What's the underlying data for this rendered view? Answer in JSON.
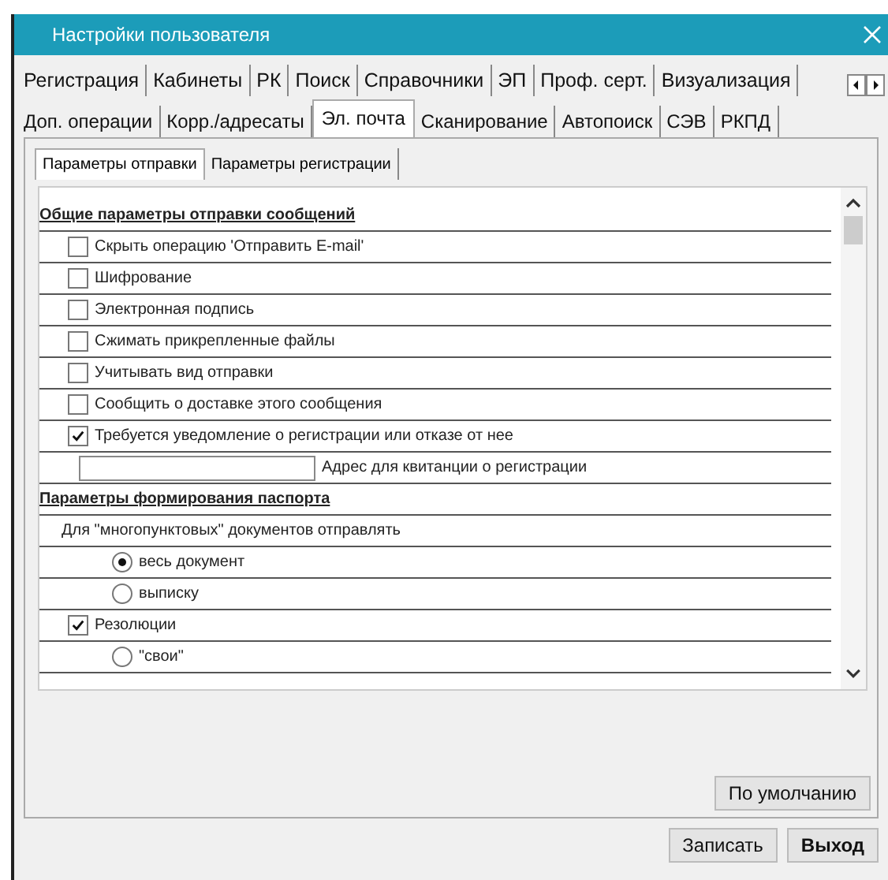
{
  "window": {
    "title": "Настройки пользователя"
  },
  "tabs_row_1": [
    {
      "label": "Регистрация",
      "selected": false
    },
    {
      "label": "Кабинеты",
      "selected": false
    },
    {
      "label": "РК",
      "selected": false
    },
    {
      "label": "Поиск",
      "selected": false
    },
    {
      "label": "Справочники",
      "selected": false
    },
    {
      "label": "ЭП",
      "selected": false
    },
    {
      "label": "Проф. серт.",
      "selected": false
    },
    {
      "label": "Визуализация",
      "selected": false
    }
  ],
  "tabs_row_2": [
    {
      "label": "Доп. операции",
      "selected": false
    },
    {
      "label": "Корр./адресаты",
      "selected": false
    },
    {
      "label": "Эл. почта",
      "selected": true
    },
    {
      "label": "Сканирование",
      "selected": false
    },
    {
      "label": "Автопоиск",
      "selected": false
    },
    {
      "label": "СЭВ",
      "selected": false
    },
    {
      "label": "РКПД",
      "selected": false
    }
  ],
  "subtabs": [
    {
      "label": "Параметры отправки",
      "selected": true
    },
    {
      "label": "Параметры регистрации",
      "selected": false
    }
  ],
  "rows": [
    {
      "kind": "heading",
      "label": "Общие параметры отправки сообщений"
    },
    {
      "kind": "checkbox",
      "label": "Скрыть операцию 'Отправить E-mail'",
      "checked": false
    },
    {
      "kind": "checkbox",
      "label": "Шифрование",
      "checked": false
    },
    {
      "kind": "checkbox",
      "label": "Электронная подпись",
      "checked": false
    },
    {
      "kind": "checkbox",
      "label": "Сжимать прикрепленные файлы",
      "checked": false
    },
    {
      "kind": "checkbox",
      "label": "Учитывать вид отправки",
      "checked": false
    },
    {
      "kind": "checkbox",
      "label": "Сообщить о доставке этого сообщения",
      "checked": false
    },
    {
      "kind": "checkbox",
      "label": "Требуется уведомление о регистрации или отказе от нее",
      "checked": true
    },
    {
      "kind": "field",
      "label": "Адрес для квитанции о регистрации"
    },
    {
      "kind": "heading",
      "label": "Параметры формирования паспорта"
    },
    {
      "kind": "text",
      "label": "Для \"многопунктовых\" документов отправлять",
      "children": [
        {
          "kind": "radio",
          "label": "весь документ",
          "selected": true
        },
        {
          "kind": "radio",
          "label": "выписку",
          "selected": false
        }
      ]
    },
    {
      "kind": "checkbox",
      "label": "Резолюции",
      "checked": true,
      "children": [
        {
          "kind": "radio",
          "label": "\"свои\"",
          "selected": false
        }
      ]
    }
  ],
  "default_button": "По умолчанию",
  "buttons": [
    {
      "label": "Записать",
      "kind": "normal"
    },
    {
      "label": "Выход",
      "kind": "bold"
    }
  ]
}
